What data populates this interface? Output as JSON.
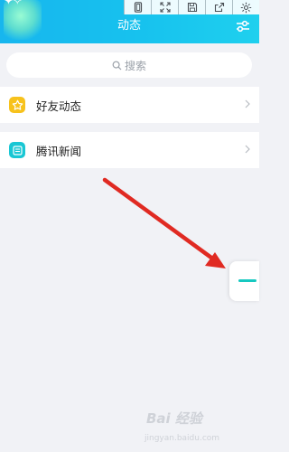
{
  "header": {
    "title": "动态",
    "settings_icon": "sliders-icon",
    "accent": "#17b6ee"
  },
  "toolbar": {
    "icons": [
      "phone-frame-icon",
      "fullscreen-icon",
      "save-icon",
      "share-icon",
      "gear-icon"
    ]
  },
  "search": {
    "placeholder": "搜索",
    "icon": "search-icon"
  },
  "list": {
    "items": [
      {
        "label": "好友动态",
        "icon": "star-icon",
        "icon_color": "#f7c21c"
      },
      {
        "label": "腾讯新闻",
        "icon": "news-icon",
        "icon_color": "#19c7d4"
      }
    ]
  },
  "swipe_tab": {
    "bar_color": "#16c8c0"
  },
  "annotation": {
    "arrow_color": "#e02a22"
  },
  "watermark": {
    "logo_text": "Bai 经验",
    "sub_text": "jingyan.baidu.com"
  }
}
